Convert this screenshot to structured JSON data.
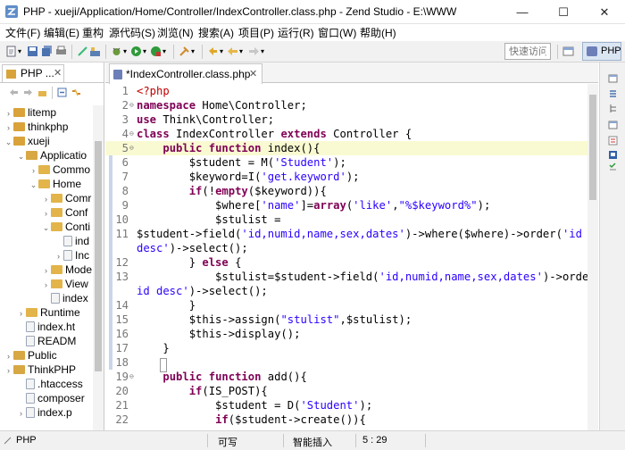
{
  "window": {
    "title": "PHP - xueji/Application/Home/Controller/IndexController.class.php - Zend Studio - E:\\WWW",
    "minimize_glyph": "—",
    "maximize_glyph": "☐",
    "close_glyph": "✕"
  },
  "menu": [
    "文件(F)",
    "编辑(E)",
    "重构",
    "源代码(S)",
    "浏览(N)",
    "搜索(A)",
    "项目(P)",
    "运行(R)",
    "窗口(W)",
    "帮助(H)"
  ],
  "toolbar": {
    "quick_access_placeholder": "快速访问",
    "perspective_label": "PHP"
  },
  "explorer": {
    "tab_label": "PHP ...",
    "close_glyph": "✕",
    "tree": [
      {
        "label": "litemp",
        "twisty": "›",
        "icon": "project"
      },
      {
        "label": "thinkphp",
        "twisty": "›",
        "icon": "project"
      },
      {
        "label": "xueji",
        "twisty": "⌄",
        "icon": "project"
      },
      {
        "label": "Application",
        "twisty": "⌄",
        "icon": "pkg"
      },
      {
        "label": "Common",
        "twisty": "›",
        "icon": "folder"
      },
      {
        "label": "Home",
        "twisty": "⌄",
        "icon": "folder"
      },
      {
        "label": "Common",
        "twisty": "›",
        "icon": "folder"
      },
      {
        "label": "Conf",
        "twisty": "›",
        "icon": "folder"
      },
      {
        "label": "Controller",
        "twisty": "⌄",
        "icon": "folder"
      },
      {
        "label": "index.html",
        "twisty": "",
        "icon": "file"
      },
      {
        "label": "IndexController",
        "twisty": "›",
        "icon": "file"
      },
      {
        "label": "Model",
        "twisty": "›",
        "icon": "folder"
      },
      {
        "label": "View",
        "twisty": "›",
        "icon": "folder"
      },
      {
        "label": "index.html",
        "twisty": "",
        "icon": "file"
      },
      {
        "label": "Runtime",
        "twisty": "›",
        "icon": "folder"
      },
      {
        "label": "index.html",
        "twisty": "",
        "icon": "file"
      },
      {
        "label": "README",
        "twisty": "",
        "icon": "file"
      },
      {
        "label": "Public",
        "twisty": "›",
        "icon": "pkg"
      },
      {
        "label": "ThinkPHP",
        "twisty": "›",
        "icon": "pkg"
      },
      {
        "label": ".htaccess",
        "twisty": "",
        "icon": "file"
      },
      {
        "label": "composer",
        "twisty": "",
        "icon": "file"
      },
      {
        "label": "index.php",
        "twisty": "›",
        "icon": "file"
      }
    ],
    "tree_visible_labels": [
      "litemp",
      "thinkphp",
      "xueji",
      "Applicatio",
      "Commo",
      "Home",
      "Comr",
      "Conf",
      "Conti",
      "ind",
      "Inc",
      "Mode",
      "View",
      "index",
      "Runtime",
      "index.ht",
      "READM",
      "Public",
      "ThinkPHP",
      ".htaccess",
      "composer",
      "index.p"
    ]
  },
  "editor": {
    "tab_label": "*IndexController.class.php",
    "close_glyph": "✕",
    "lines": [
      {
        "n": "1",
        "fold": "",
        "hl": false,
        "html": "<span class=\"tag\">&lt;?php</span>"
      },
      {
        "n": "2",
        "fold": "⊖",
        "hl": false,
        "html": "<span class=\"kw\">namespace</span> Home\\Controller;"
      },
      {
        "n": "3",
        "fold": "",
        "hl": false,
        "html": "<span class=\"kw\">use</span> Think\\Controller;"
      },
      {
        "n": "4",
        "fold": "⊖",
        "hl": false,
        "html": "<span class=\"kw\">class</span> IndexController <span class=\"kw\">extends</span> Controller {"
      },
      {
        "n": "5",
        "fold": "⊖",
        "hl": true,
        "html": "    <span class=\"kw\">public</span> <span class=\"kw\">function</span> index(){"
      },
      {
        "n": "6",
        "fold": "",
        "hl": false,
        "html": "        $student = M(<span class=\"str\">'Student'</span>);"
      },
      {
        "n": "7",
        "fold": "",
        "hl": false,
        "html": "        $keyword=I(<span class=\"str\">'get.keyword'</span>);"
      },
      {
        "n": "8",
        "fold": "",
        "hl": false,
        "html": "        <span class=\"kw\">if</span>(!<span class=\"kw\">empty</span>($keyword)){"
      },
      {
        "n": "9",
        "fold": "",
        "hl": false,
        "html": "            $where[<span class=\"str\">'name'</span>]=<span class=\"kw\">array</span>(<span class=\"str\">'like'</span>,<span class=\"str\">\"%$keyword%\"</span>);"
      },
      {
        "n": "10",
        "fold": "",
        "hl": false,
        "html": "            $stulist ="
      },
      {
        "n": "11",
        "fold": "",
        "hl": false,
        "html": "$student-&gt;field(<span class=\"str\">'id,numid,name,sex,dates'</span>)-&gt;where($where)-&gt;order(<span class=\"str\">'id</span>"
      },
      {
        "n": "",
        "fold": "",
        "hl": false,
        "html": "<span class=\"str\">desc'</span>)-&gt;select();"
      },
      {
        "n": "12",
        "fold": "",
        "hl": false,
        "html": "        } <span class=\"kw\">else</span> {"
      },
      {
        "n": "13",
        "fold": "",
        "hl": false,
        "html": "            $stulist=$student-&gt;field(<span class=\"str\">'id,numid,name,sex,dates'</span>)-&gt;order(<span class=\"str\">'</span>"
      },
      {
        "n": "",
        "fold": "",
        "hl": false,
        "html": "<span class=\"str\">id desc'</span>)-&gt;select();"
      },
      {
        "n": "14",
        "fold": "",
        "hl": false,
        "html": "        }"
      },
      {
        "n": "15",
        "fold": "",
        "hl": false,
        "html": "        $this-&gt;assign(<span class=\"str\">\"stulist\"</span>,$stulist);"
      },
      {
        "n": "16",
        "fold": "",
        "hl": false,
        "html": "        $this-&gt;display();"
      },
      {
        "n": "17",
        "fold": "",
        "hl": false,
        "html": "    }"
      },
      {
        "n": "18",
        "fold": "",
        "hl": false,
        "html": ""
      },
      {
        "n": "19",
        "fold": "⊖",
        "hl": false,
        "html": "    <span class=\"kw\">public</span> <span class=\"kw\">function</span> add(){"
      },
      {
        "n": "20",
        "fold": "",
        "hl": false,
        "html": "        <span class=\"kw\">if</span>(IS_POST){"
      },
      {
        "n": "21",
        "fold": "",
        "hl": false,
        "html": "            $student = D(<span class=\"str\">'Student'</span>);"
      },
      {
        "n": "22",
        "fold": "",
        "hl": false,
        "html": "            <span class=\"kw\">if</span>($student-&gt;create()){"
      }
    ],
    "visible_line_numbers": [
      "1",
      "2",
      "3",
      "4",
      "5",
      "6",
      "7",
      "8",
      "9",
      "10",
      "11",
      "12",
      "13",
      "14",
      "15",
      "16",
      "17",
      "18",
      "19",
      "20",
      "21",
      "22"
    ]
  },
  "status": {
    "language": "PHP",
    "writable": "可写",
    "insert_mode": "智能插入",
    "cursor_position": "5 : 29"
  }
}
